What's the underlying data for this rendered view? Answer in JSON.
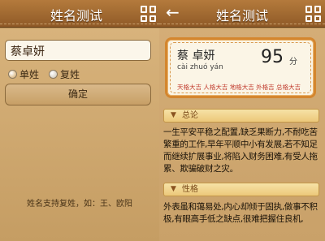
{
  "left": {
    "title": "姓名测试",
    "name_value": "蔡卓妍",
    "radio_single": "单姓",
    "radio_compound": "复姓",
    "confirm_label": "确定",
    "tip": "姓名支持复姓，如：王、欧阳"
  },
  "right": {
    "title": "姓名测试",
    "card": {
      "name": "蔡 卓妍",
      "pinyin": "cài zhuó yán",
      "score": "95",
      "unit": "分",
      "tags": "天格大吉 人格大吉 地格大吉 外格吉 总格大吉"
    },
    "sections": [
      {
        "title": "总论",
        "text": "一生平安平稳之配置,缺乏果断力,不耐吃苦繁重的工作,早年平顺中小有发展,若不知足而继续扩展事业,将陷入财务困难,有受人拖累、欺骗破财之灾。"
      },
      {
        "title": "性格",
        "text": "外表虽和蔼易处,内心却倾于固执,做事不积极,有眼高手低之缺点,很难把握住良机,"
      }
    ]
  },
  "icons": {
    "grid": "grid-menu-icon",
    "back": "back-arrow-icon",
    "section": "down-arrow-icon"
  },
  "colors": {
    "header": "#8f5a27",
    "accent": "#d4862e",
    "tag_red": "#c0392b"
  }
}
